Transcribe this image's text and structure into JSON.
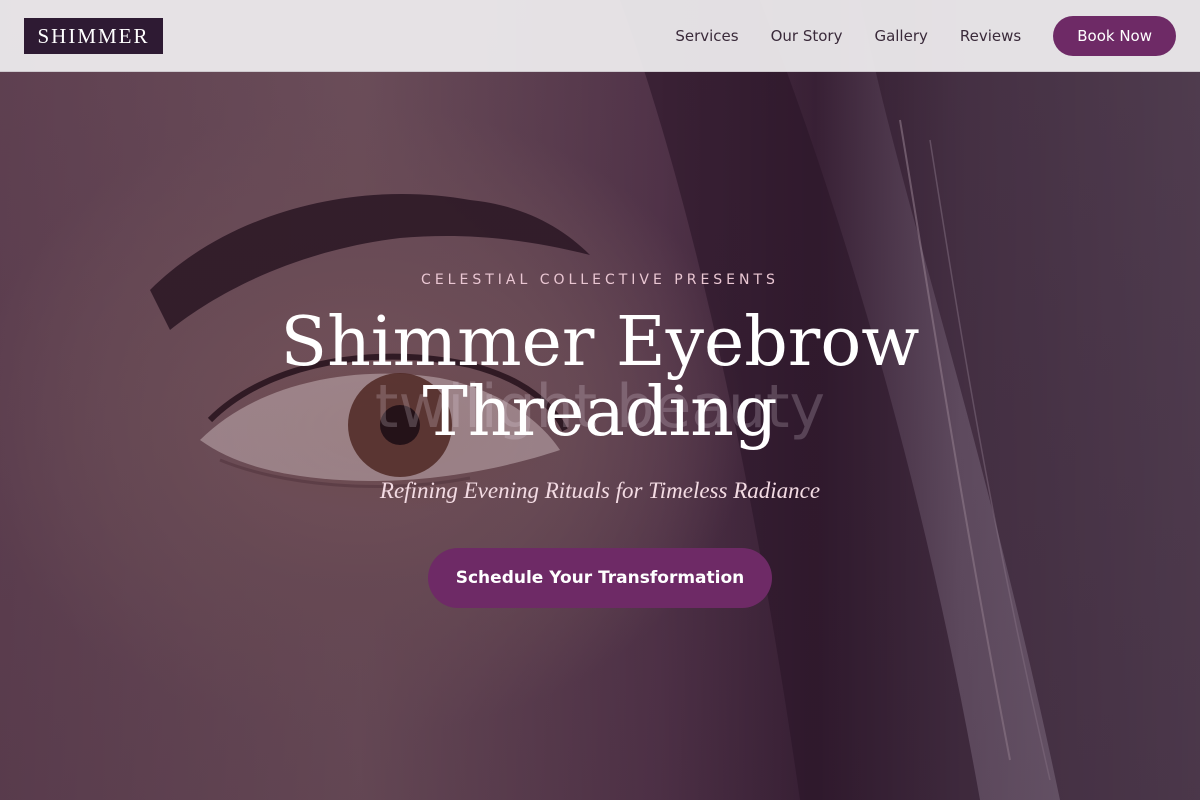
{
  "header": {
    "logo_text": "SHIMMER",
    "nav": [
      {
        "label": "Services"
      },
      {
        "label": "Our Story"
      },
      {
        "label": "Gallery"
      },
      {
        "label": "Reviews"
      }
    ],
    "book_label": "Book Now"
  },
  "hero": {
    "eyebrow": "CELESTIAL COLLECTIVE PRESENTS",
    "ghost_text": "twilight beauty",
    "title_line1": "Shimmer Eyebrow",
    "title_line2": "Threading",
    "subtitle": "Refining Evening Rituals for Timeless Radiance",
    "cta_label": "Schedule Your Transformation"
  },
  "colors": {
    "accent": "#6e2a66",
    "logo_bg": "#2e1a33",
    "header_bg": "#eeecee",
    "eyebrow_text": "#e9c6d2"
  }
}
